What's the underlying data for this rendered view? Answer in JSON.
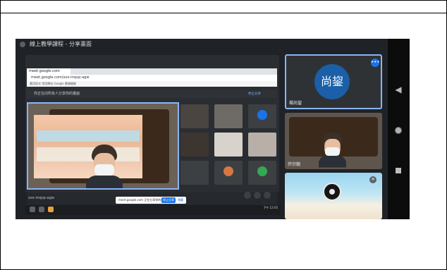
{
  "meeting": {
    "title": "線上教學課程 - 分享畫面"
  },
  "browser": {
    "tab_label": "meet.google.com",
    "url": "meet.google.com/xxx-mqvp-agw",
    "bookmarks": "應用程式   常用網站   Google 雲端硬碟"
  },
  "presenter_bar": {
    "text": "你正在向所有人分享你的畫面",
    "link": "停止分享"
  },
  "bottom": {
    "meeting_code": "xxx-mqvp-agw",
    "share_notice": "meet.google.com 正在分享你的畫面。",
    "share_stop": "停止分享",
    "share_hide": "隱藏"
  },
  "participants": [
    {
      "name": "",
      "avatar_color": "#3c4043"
    },
    {
      "name": "",
      "avatar_color": "#3c4043"
    },
    {
      "name": "",
      "avatar_color": "#1a73e8"
    },
    {
      "name": "",
      "avatar_color": "#3c4043"
    },
    {
      "name": "",
      "avatar_color": "#3c4043"
    },
    {
      "name": "",
      "avatar_color": "#3c4043"
    },
    {
      "name": "",
      "avatar_color": "#3c4043"
    },
    {
      "name": "",
      "avatar_color": "#d97742"
    },
    {
      "name": "",
      "avatar_color": "#34a853"
    }
  ],
  "right_tiles": {
    "main_avatar_text": "尚鋆",
    "main_name": "楊尚鋆",
    "second_name": "許宗翰"
  },
  "taskbar": {
    "clock": "下午 12:05"
  },
  "colors": {
    "accent": "#8ab4f8",
    "brand_blue": "#1a73e8",
    "dark_bg": "#1f2226"
  }
}
